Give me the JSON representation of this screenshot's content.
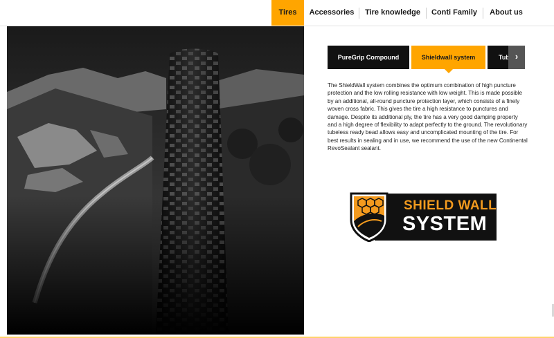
{
  "nav": {
    "items": [
      {
        "label": "Tires",
        "active": true
      },
      {
        "label": "Accessories",
        "active": false
      },
      {
        "label": "Tire knowledge",
        "active": false
      },
      {
        "label": "Conti Family",
        "active": false
      },
      {
        "label": "About us",
        "active": false
      }
    ]
  },
  "tabs": [
    {
      "label": "PureGrip Compound",
      "active": false
    },
    {
      "label": "Shieldwall system",
      "active": true
    },
    {
      "label": "Tub",
      "active": false
    }
  ],
  "tab_next_icon": "chevron-right-icon",
  "description": "The ShieldWall system combines the optimum combination of high puncture protection and the low rolling resistance with low weight. This is made possible by an additional, all-round puncture protection layer, which consists of a finely woven cross fabric. This gives the tire a high resistance to punctures and damage. Despite its additional ply, the tire has a very good damping property and a high degree of flexibility to adapt perfectly to the ground. The revolutionary tubeless ready bead allows easy and uncomplicated mounting of the tire. For best results in sealing and in use, we recommend the use of the new Continental RevoSealant sealant.",
  "logo": {
    "line1": "SHIELD WALL",
    "line2": "SYSTEM"
  },
  "colors": {
    "accent": "#ffa500",
    "dark": "#111111",
    "logo_orange": "#f39a1e"
  }
}
